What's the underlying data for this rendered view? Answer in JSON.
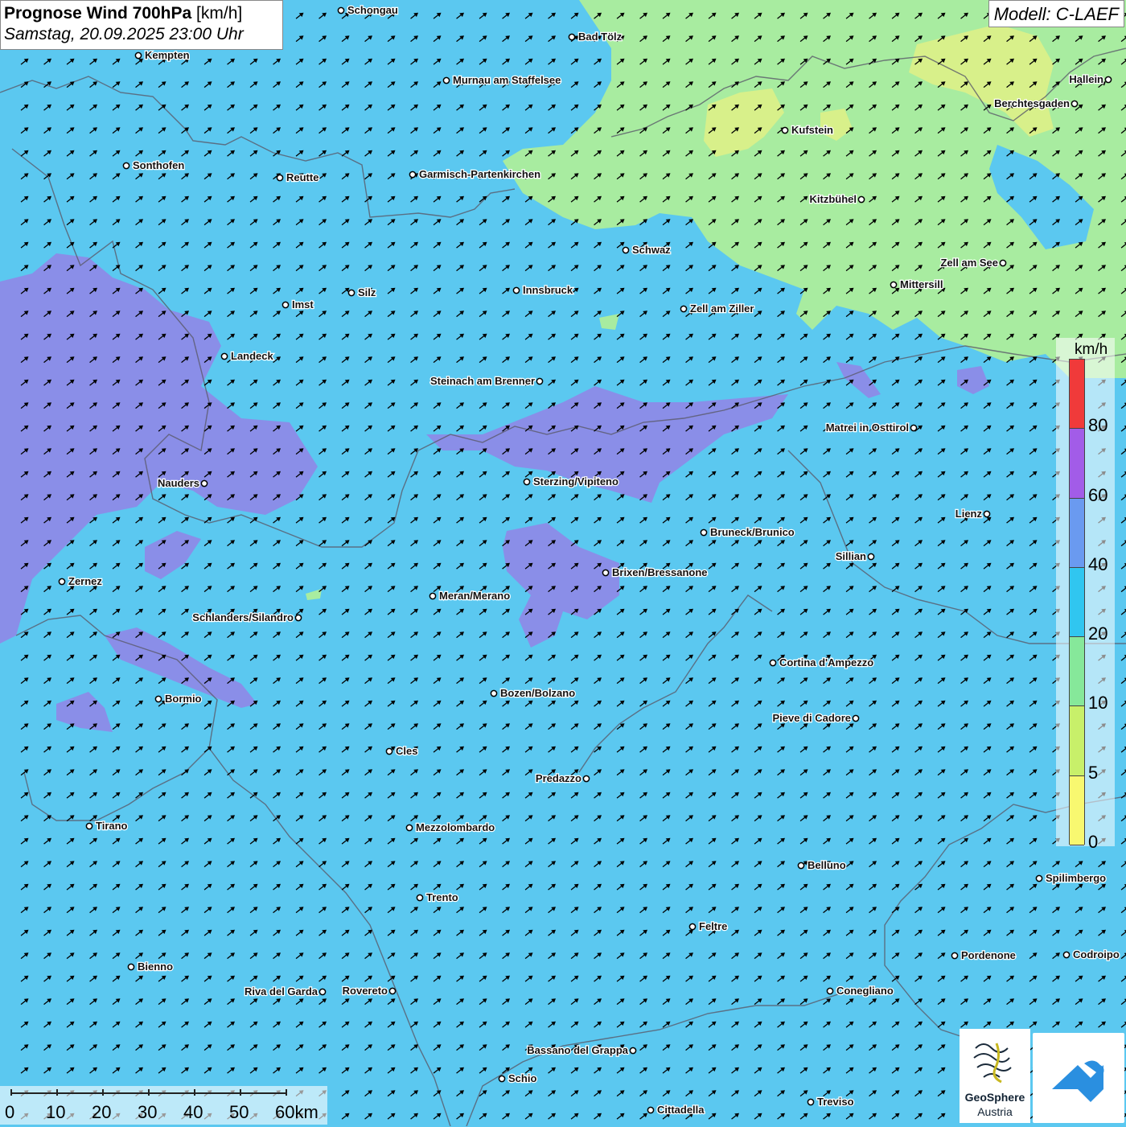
{
  "header": {
    "title_bold": "Prognose Wind 700hPa",
    "title_unit": "[km/h]",
    "datetime": "Samstag, 20.09.2025 23:00 Uhr"
  },
  "model": "Modell: C-LAEF",
  "legend": {
    "unit": "km/h",
    "labels": [
      "80",
      "60",
      "40",
      "20",
      "10",
      "5",
      "0"
    ],
    "segment_colors": [
      "#f03a3a",
      "#a25ce8",
      "#6a9af0",
      "#30c6f0",
      "#86e89a",
      "#c8f06a",
      "#f8f870"
    ]
  },
  "scale": {
    "labels": [
      "0",
      "10",
      "20",
      "30",
      "40",
      "50",
      "60km"
    ]
  },
  "logo": {
    "name": "GeoSphere",
    "sub": "Austria"
  },
  "colors": {
    "base": "#5bc8f0",
    "green_zone": "#a8eca0",
    "yellow_zone": "#d8f08a",
    "purple_zone": "#8a8ee8"
  },
  "wind_arrow_icon": "northeast-arrow",
  "cities": [
    {
      "name": "Schongau"
    },
    {
      "name": "Bad Tölz"
    },
    {
      "name": "Kempten"
    },
    {
      "name": "Murnau am Staffelsee"
    },
    {
      "name": "Hallein"
    },
    {
      "name": "Berchtesgaden"
    },
    {
      "name": "Kufstein"
    },
    {
      "name": "Sonthofen"
    },
    {
      "name": "Reutte"
    },
    {
      "name": "Garmisch-Partenkirchen"
    },
    {
      "name": "Kitzbühel"
    },
    {
      "name": "Schwaz"
    },
    {
      "name": "Zell am See"
    },
    {
      "name": "Mittersill"
    },
    {
      "name": "Imst"
    },
    {
      "name": "Silz"
    },
    {
      "name": "Innsbruck"
    },
    {
      "name": "Zell am Ziller"
    },
    {
      "name": "Landeck"
    },
    {
      "name": "Steinach am Brenner"
    },
    {
      "name": "Matrei in Osttirol"
    },
    {
      "name": "Nauders"
    },
    {
      "name": "Sterzing/Vipiteno"
    },
    {
      "name": "Lienz"
    },
    {
      "name": "Bruneck/Brunico"
    },
    {
      "name": "Sillian"
    },
    {
      "name": "Zernez"
    },
    {
      "name": "Brixen/Bressanone"
    },
    {
      "name": "Meran/Merano"
    },
    {
      "name": "Schlanders/Silandro"
    },
    {
      "name": "Cortina d'Ampezzo"
    },
    {
      "name": "Bormio"
    },
    {
      "name": "Bozen/Bolzano"
    },
    {
      "name": "Pieve di Cadore"
    },
    {
      "name": "Cles"
    },
    {
      "name": "Predazzo"
    },
    {
      "name": "Tirano"
    },
    {
      "name": "Mezzolombardo"
    },
    {
      "name": "Belluno"
    },
    {
      "name": "Spilimbergo"
    },
    {
      "name": "Trento"
    },
    {
      "name": "Feltre"
    },
    {
      "name": "Bienno"
    },
    {
      "name": "Pordenone"
    },
    {
      "name": "Codroipo"
    },
    {
      "name": "Riva del Garda"
    },
    {
      "name": "Rovereto"
    },
    {
      "name": "Conegliano"
    },
    {
      "name": "Bassano del Grappa"
    },
    {
      "name": "Schio"
    },
    {
      "name": "Treviso"
    },
    {
      "name": "Cittadella"
    }
  ]
}
